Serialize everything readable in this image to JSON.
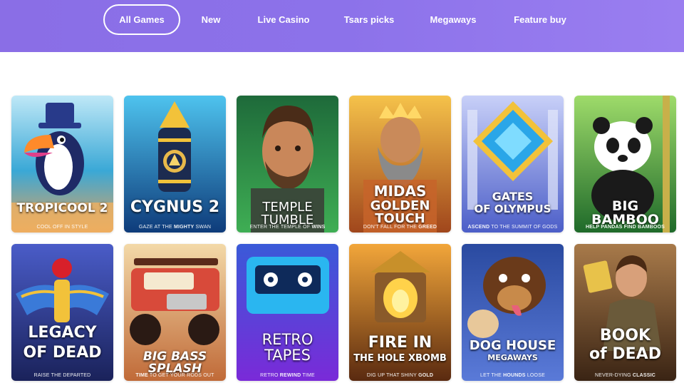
{
  "nav": {
    "tabs": [
      {
        "label": "All Games",
        "active": true
      },
      {
        "label": "New",
        "active": false
      },
      {
        "label": "Live Casino",
        "active": false
      },
      {
        "label": "Tsars picks",
        "active": false
      },
      {
        "label": "Megaways",
        "active": false
      },
      {
        "label": "Feature buy",
        "active": false
      }
    ]
  },
  "games": [
    {
      "title": "TROPICOOL 2",
      "tag_before": "COOL OFF ",
      "tag_bold": "",
      "tag_after": "IN STYLE",
      "bg": "#2fa3c8",
      "icon": "toucan-icon"
    },
    {
      "title": "CYGNUS 2",
      "tag_before": "GAZE AT THE ",
      "tag_bold": "MIGHTY",
      "tag_after": " SWAN",
      "bg": "#1c6fae",
      "icon": "swan-tower-icon"
    },
    {
      "title": "TEMPLE TUMBLE",
      "tag_before": "ENTER THE TEMPLE OF ",
      "tag_bold": "WINS",
      "tag_after": "",
      "bg": "#2e8a4a",
      "icon": "explorer-icon"
    },
    {
      "title": "MIDAS",
      "title2": "GOLDEN TOUCH",
      "tag_before": "DON'T FALL FOR THE ",
      "tag_bold": "GREED",
      "tag_after": "",
      "bg": "#c7792a",
      "icon": "midas-icon"
    },
    {
      "title": "GATES",
      "title2": "OF OLYMPUS",
      "tag_before": "",
      "tag_bold": "ASCEND",
      "tag_after": " TO THE SUMMIT OF GODS",
      "bg": "#6f7fd8",
      "icon": "gem-icon"
    },
    {
      "title": "BIG BAMBOO",
      "tag_before": "",
      "tag_bold": "HELP PANDAS FIND BAMBOOS",
      "tag_after": "",
      "bg": "#3d8a3a",
      "icon": "panda-icon"
    },
    {
      "title": "LEGACY",
      "title2": "OF DEAD",
      "tag_before": "RAISE THE DEPARTED",
      "tag_bold": "",
      "tag_after": "",
      "bg": "#3b4fa8",
      "icon": "scarab-icon"
    },
    {
      "title": "BIG BASS SPLASH",
      "tag_before": "",
      "tag_bold": "TIME",
      "tag_after": " TO GET YOUR RODS OUT",
      "bg": "#b8603b",
      "icon": "truck-icon"
    },
    {
      "title": "RETRO",
      "title2": "TAPES",
      "tag_before": "RETRO ",
      "tag_bold": "REWIND",
      "tag_after": " TIME",
      "bg": "#6a3fd0",
      "icon": "cassette-icon"
    },
    {
      "title": "FIRE IN",
      "title2": "THE HOLE XBOMB",
      "tag_before": "DIG UP THAT SHINY ",
      "tag_bold": "GOLD",
      "tag_after": "",
      "bg": "#8a4a20",
      "icon": "lantern-icon"
    },
    {
      "title": "DOG HOUSE",
      "title2": "MEGAWAYS",
      "tag_before": "LET THE ",
      "tag_bold": "HOUNDS",
      "tag_after": " LOOSE",
      "bg": "#3b5aa8",
      "icon": "dog-icon"
    },
    {
      "title": "BOOK",
      "title2": "of DEAD",
      "tag_before": "NEVER-DYING ",
      "tag_bold": "CLASSIC",
      "tag_after": "",
      "bg": "#7a5030",
      "icon": "adventurer-icon"
    }
  ]
}
